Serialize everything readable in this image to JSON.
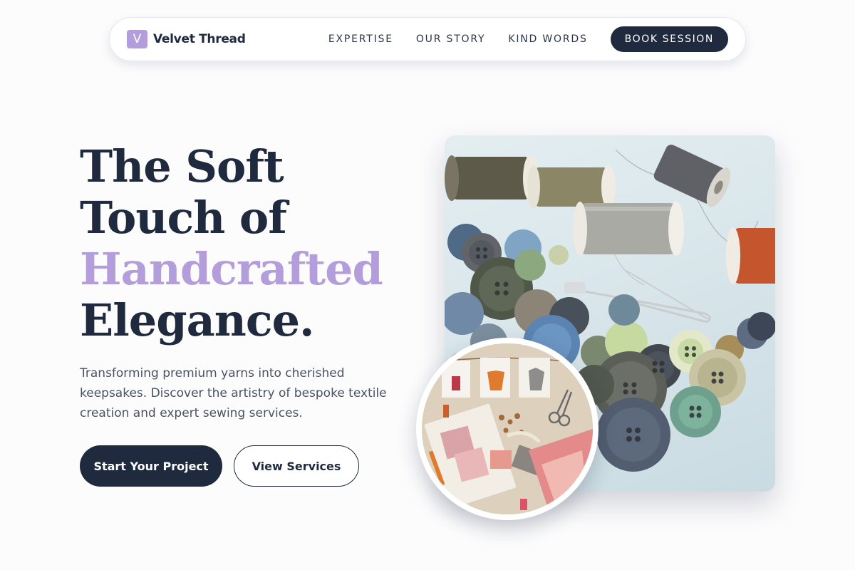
{
  "brand": {
    "logo_letter": "V",
    "name": "Velvet Thread"
  },
  "nav": {
    "links": [
      "EXPERTISE",
      "OUR STORY",
      "KIND WORDS"
    ],
    "cta_label": "BOOK SESSION"
  },
  "hero": {
    "title_line_1": "The Soft",
    "title_line_2": "Touch of",
    "title_line_3": "Handcrafted",
    "title_line_4": "Elegance.",
    "description": "Transforming premium yarns into cherished keepsakes. Discover the artistry of bespoke textile creation and expert sewing services.",
    "primary_button": "Start Your Project",
    "secondary_button": "View Services"
  },
  "images": {
    "main_photo": "sewing-buttons-spools-photo",
    "inset_photo": "fabric-swatches-sketches-photo"
  },
  "colors": {
    "primary": "#1f2a3e",
    "accent": "#b39ddb",
    "background": "#fcfcfd",
    "text_muted": "#4a5263"
  }
}
